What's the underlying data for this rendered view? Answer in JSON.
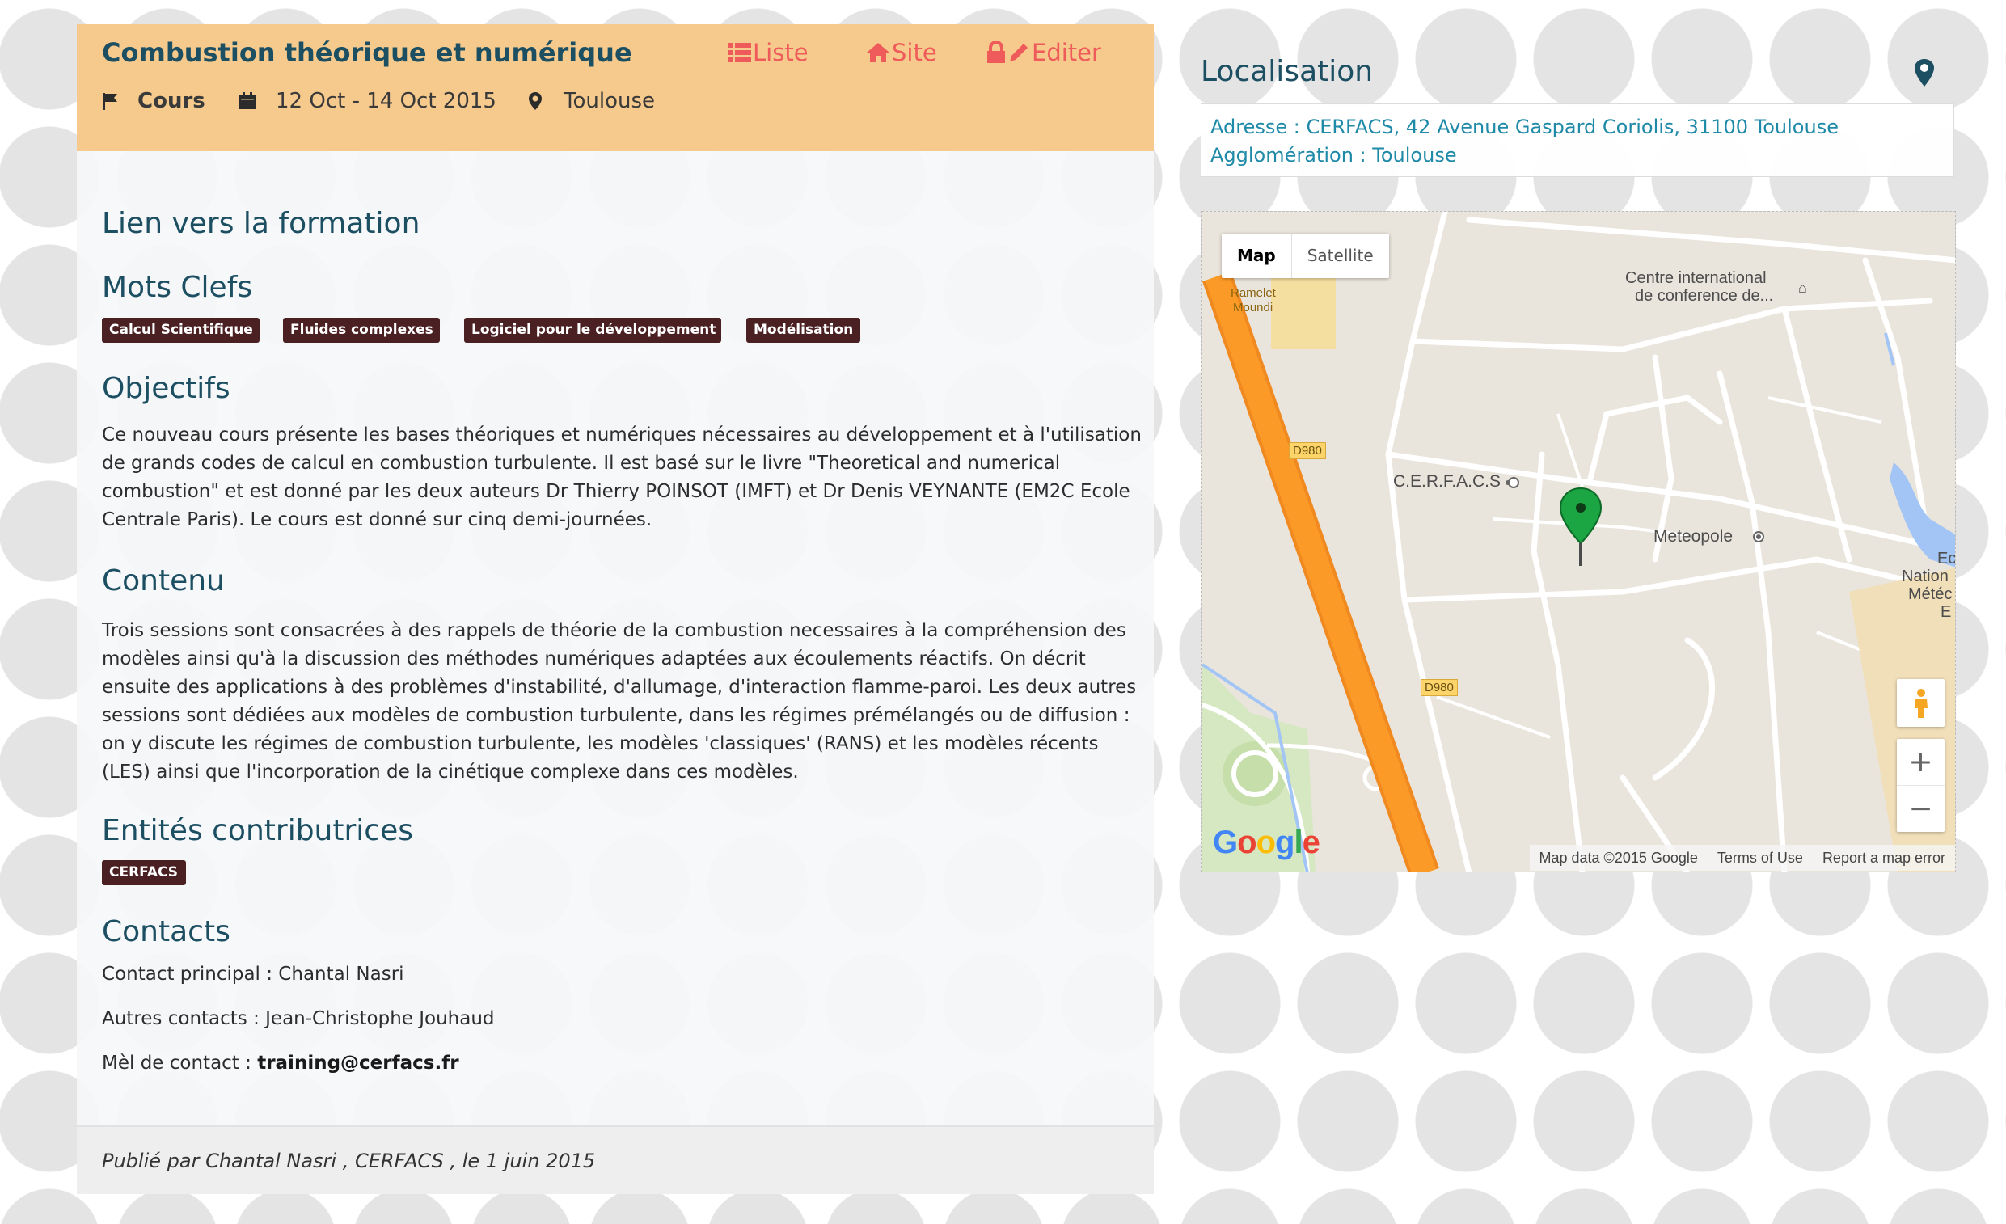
{
  "event": {
    "title": "Combustion théorique et numérique",
    "actions": {
      "liste": "Liste",
      "site": "Site",
      "editer": "Editer"
    },
    "type": "Cours",
    "dates": "12 Oct - 14 Oct 2015",
    "location": "Toulouse"
  },
  "sections": {
    "link": "Lien vers la formation",
    "keywords": "Mots Clefs",
    "objectives": "Objectifs",
    "content": "Contenu",
    "entities": "Entités contributrices",
    "contacts": "Contacts"
  },
  "keywords": [
    "Calcul Scientifique",
    "Fluides complexes",
    "Logiciel pour le développement",
    "Modélisation"
  ],
  "objectives_text": "Ce nouveau cours présente les bases théoriques et numériques nécessaires au développement et à l'utilisation de grands codes de calcul en combustion turbulente. Il est basé sur le livre \"Theoretical and numerical combustion\" et est donné par les deux auteurs Dr Thierry POINSOT (IMFT) et Dr Denis VEYNANTE (EM2C Ecole Centrale Paris). Le cours est donné sur cinq demi-journées.",
  "content_text": "Trois sessions sont consacrées à des rappels de théorie de la combustion necessaires à la compréhension des modèles ainsi qu'à la discussion des méthodes numériques adaptées aux écoulements réactifs. On décrit ensuite des applications à des problèmes d'instabilité, d'allumage, d'interaction flamme-paroi. Les deux autres sessions sont dédiées aux modèles de combustion turbulente, dans les régimes prémélangés ou de diffusion : on y discute les régimes de combustion turbulente, les modèles 'classiques' (RANS) et les modèles récents (LES) ainsi que l'incorporation de la cinétique complexe dans ces modèles.",
  "entity": "CERFACS",
  "contacts": {
    "main": "Contact principal : Chantal Nasri",
    "others": "Autres contacts : Jean-Christophe Jouhaud",
    "mail_label": "Mèl de contact : ",
    "mail": "training@cerfacs.fr"
  },
  "footer": "Publié par Chantal Nasri , CERFACS , le 1 juin 2015",
  "localisation": {
    "title": "Localisation",
    "address": "Adresse : CERFACS, 42 Avenue Gaspard Coriolis, 31100 Toulouse",
    "agglomeration": "Agglomération : Toulouse"
  },
  "map": {
    "type_map": "Map",
    "type_satellite": "Satellite",
    "labels": {
      "ramelet_1": "Ramelet",
      "ramelet_2": "Moundi",
      "centre_1": "Centre international",
      "centre_2": "de conference de...",
      "cerfacs": "C.E.R.F.A.C.S",
      "meteopole": "Meteopole",
      "road_1": "D980",
      "road_2": "D980",
      "edge_1": "Ec",
      "edge_2": "Nation",
      "edge_3": "Météc",
      "edge_4": "E"
    },
    "zoom_in": "+",
    "zoom_out": "−",
    "logo": "Google",
    "attribution": {
      "data": "Map data ©2015 Google",
      "terms": "Terms of Use",
      "report": "Report a map error"
    },
    "colors": {
      "highway": "#fc9a27",
      "marker": "#1ba543",
      "water": "#a3c5f5"
    }
  }
}
